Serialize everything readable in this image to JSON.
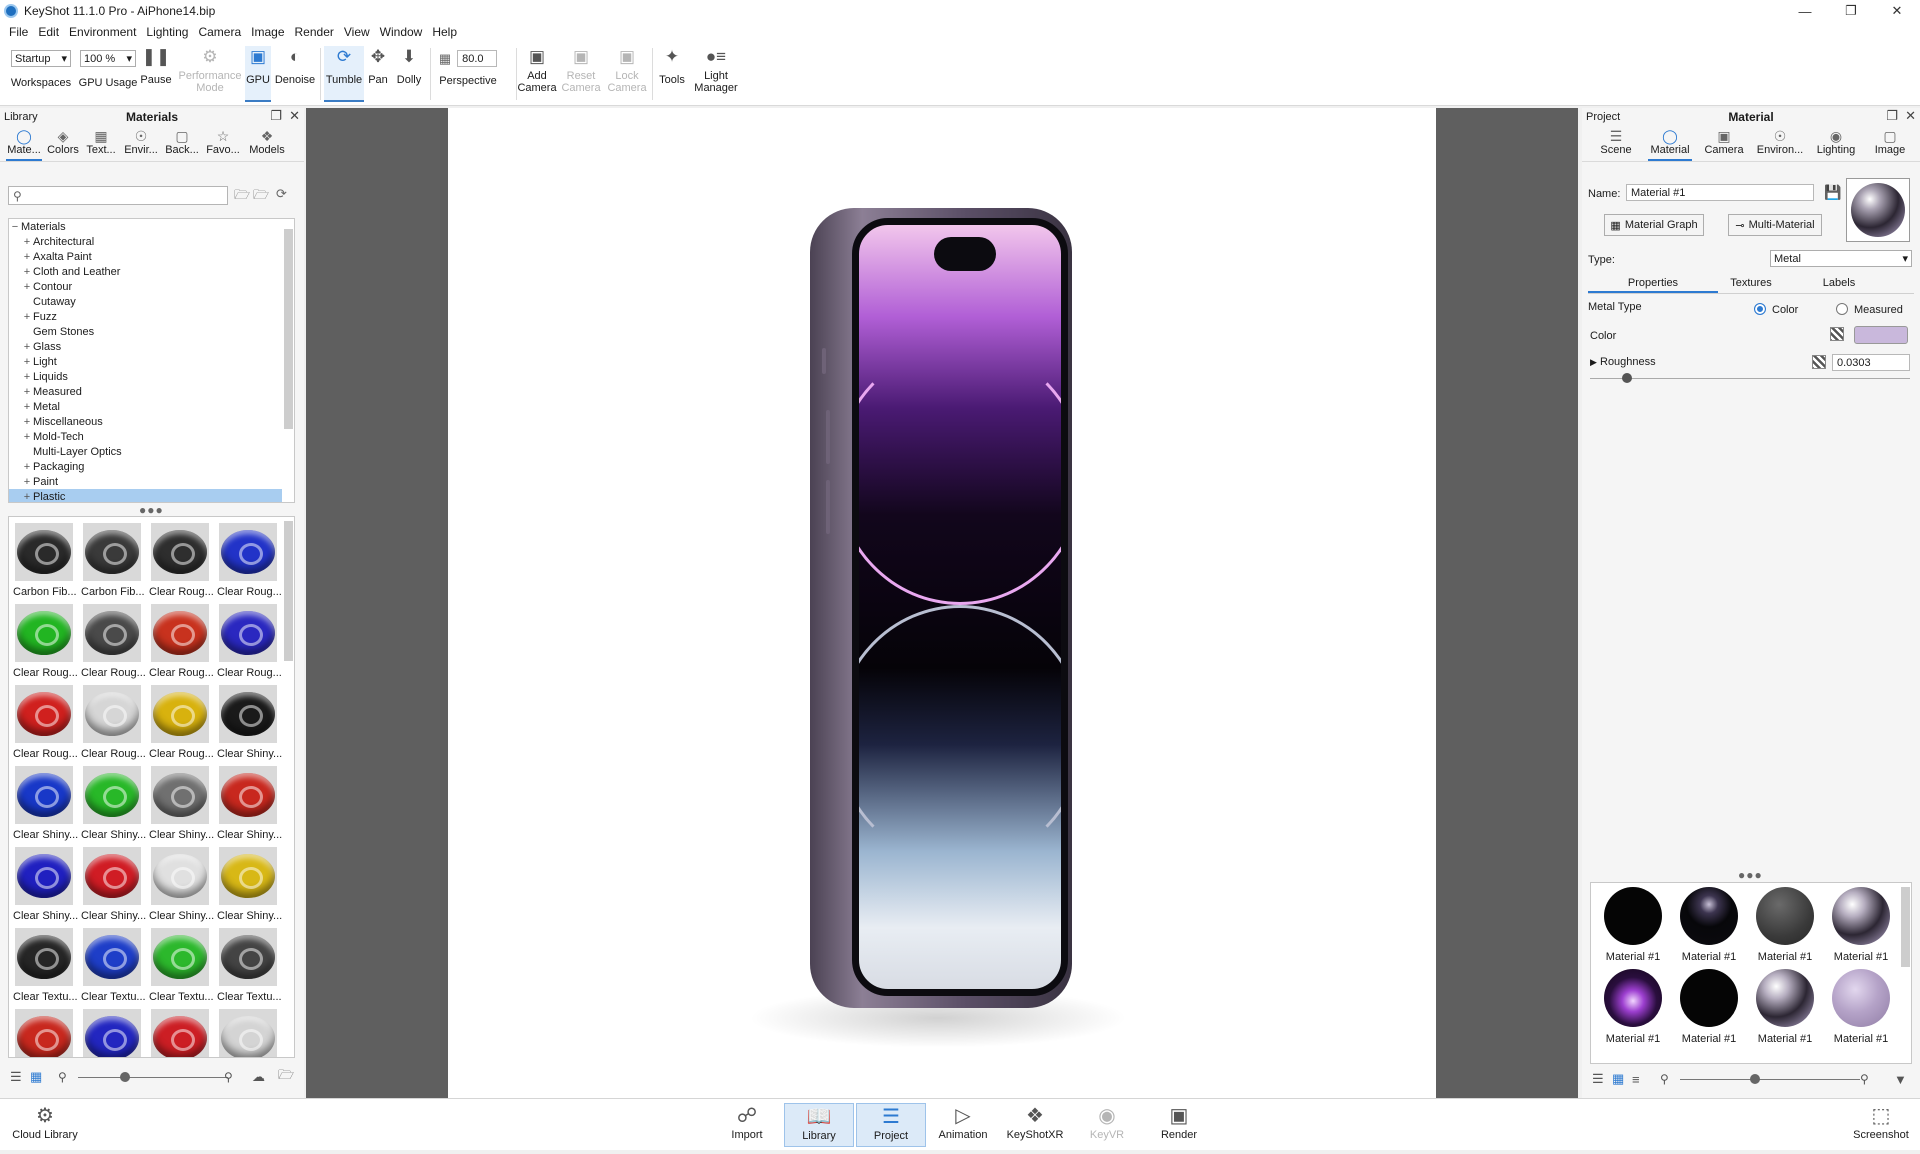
{
  "title": "KeyShot 11.1.0 Pro  - AiPhone14.bip",
  "menu": [
    "File",
    "Edit",
    "Environment",
    "Lighting",
    "Camera",
    "Image",
    "Render",
    "View",
    "Window",
    "Help"
  ],
  "toolbar": {
    "workspace_value": "Startup",
    "workspaces": "Workspaces",
    "gpu_usage_value": "100 %",
    "gpu_usage": "GPU Usage",
    "pause": "Pause",
    "performance_mode": "Performance Mode",
    "gpu": "GPU",
    "denoise": "Denoise",
    "tumble": "Tumble",
    "pan": "Pan",
    "dolly": "Dolly",
    "fov_value": "80.0",
    "perspective": "Perspective",
    "add_camera": "Add Camera",
    "reset_camera": "Reset Camera",
    "lock_camera": "Lock Camera",
    "tools": "Tools",
    "light_manager": "Light Manager"
  },
  "library": {
    "header_left": "Library",
    "header_title": "Materials",
    "tabs": [
      "Mate...",
      "Colors",
      "Text...",
      "Envir...",
      "Back...",
      "Favo...",
      "Models"
    ],
    "search_placeholder": "",
    "tree_root": "Materials",
    "tree": [
      {
        "label": "Architectural",
        "exp": true
      },
      {
        "label": "Axalta Paint",
        "exp": true
      },
      {
        "label": "Cloth and Leather",
        "exp": true
      },
      {
        "label": "Contour",
        "exp": true
      },
      {
        "label": "Cutaway",
        "exp": false
      },
      {
        "label": "Fuzz",
        "exp": true
      },
      {
        "label": "Gem Stones",
        "exp": false
      },
      {
        "label": "Glass",
        "exp": true
      },
      {
        "label": "Light",
        "exp": true
      },
      {
        "label": "Liquids",
        "exp": true
      },
      {
        "label": "Measured",
        "exp": true
      },
      {
        "label": "Metal",
        "exp": true
      },
      {
        "label": "Miscellaneous",
        "exp": true
      },
      {
        "label": "Mold-Tech",
        "exp": true
      },
      {
        "label": "Multi-Layer Optics",
        "exp": false
      },
      {
        "label": "Packaging",
        "exp": true
      },
      {
        "label": "Paint",
        "exp": true
      },
      {
        "label": "Plastic",
        "exp": true,
        "selected": true
      }
    ],
    "thumbs": [
      {
        "cap": "Carbon Fib...",
        "color": "#2a2a2a"
      },
      {
        "cap": "Carbon Fib...",
        "color": "#3a3a3a"
      },
      {
        "cap": "Clear Roug...",
        "color": "#2e2e2e"
      },
      {
        "cap": "Clear Roug...",
        "color": "#2233c8"
      },
      {
        "cap": "Clear Roug...",
        "color": "#22b522"
      },
      {
        "cap": "Clear Roug...",
        "color": "#4a4a4a"
      },
      {
        "cap": "Clear Roug...",
        "color": "#c8321e"
      },
      {
        "cap": "Clear Roug...",
        "color": "#2a28c0"
      },
      {
        "cap": "Clear Roug...",
        "color": "#d0201e"
      },
      {
        "cap": "Clear Roug...",
        "color": "#d6d6d6"
      },
      {
        "cap": "Clear Roug...",
        "color": "#d8b20e"
      },
      {
        "cap": "Clear Shiny...",
        "color": "#1a1a1a"
      },
      {
        "cap": "Clear Shiny...",
        "color": "#1838c8"
      },
      {
        "cap": "Clear Shiny...",
        "color": "#28b828"
      },
      {
        "cap": "Clear Shiny...",
        "color": "#707070"
      },
      {
        "cap": "Clear Shiny...",
        "color": "#c8281e"
      },
      {
        "cap": "Clear Shiny...",
        "color": "#2020c0"
      },
      {
        "cap": "Clear Shiny...",
        "color": "#d01c24"
      },
      {
        "cap": "Clear Shiny...",
        "color": "#e0e0e0"
      },
      {
        "cap": "Clear Shiny...",
        "color": "#d8b816"
      },
      {
        "cap": "Clear Textu...",
        "color": "#262626"
      },
      {
        "cap": "Clear Textu...",
        "color": "#1e3ec8"
      },
      {
        "cap": "Clear Textu...",
        "color": "#2cb82c"
      },
      {
        "cap": "Clear Textu...",
        "color": "#444444"
      },
      {
        "cap": "",
        "color": "#c8281e"
      },
      {
        "cap": "",
        "color": "#2226c0"
      },
      {
        "cap": "",
        "color": "#cc1e24"
      },
      {
        "cap": "",
        "color": "#d4d4d4"
      }
    ]
  },
  "project": {
    "header_left": "Project",
    "header_title": "Material",
    "tabs": [
      "Scene",
      "Material",
      "Camera",
      "Environ...",
      "Lighting",
      "Image"
    ],
    "name_label": "Name:",
    "name_value": "Material  #1",
    "material_graph": "Material Graph",
    "multi_material": "Multi-Material",
    "type_label": "Type:",
    "type_value": "Metal",
    "subtabs": [
      "Properties",
      "Textures",
      "Labels"
    ],
    "metal_type_label": "Metal Type",
    "opt_color": "Color",
    "opt_measured": "Measured",
    "color_label": "Color",
    "color_value": "#c9b8dc",
    "roughness_label": "Roughness",
    "roughness_value": "0.0303",
    "swatches": [
      {
        "cap": "Material  #1",
        "style": "black"
      },
      {
        "cap": "Material  #1",
        "style": "darkspec"
      },
      {
        "cap": "Material  #1",
        "style": "grey"
      },
      {
        "cap": "Material  #1",
        "style": "chrome"
      },
      {
        "cap": "Material  #1",
        "style": "purple"
      },
      {
        "cap": "Material  #1",
        "style": "black"
      },
      {
        "cap": "Material  #1",
        "style": "chrome"
      },
      {
        "cap": "Material  #1",
        "style": "lilac"
      }
    ]
  },
  "bottombar": {
    "cloud_library": "Cloud Library",
    "import": "Import",
    "library": "Library",
    "project": "Project",
    "animation": "Animation",
    "keyshotxr": "KeyShotXR",
    "keyvr": "KeyVR",
    "render": "Render",
    "screenshot": "Screenshot"
  }
}
